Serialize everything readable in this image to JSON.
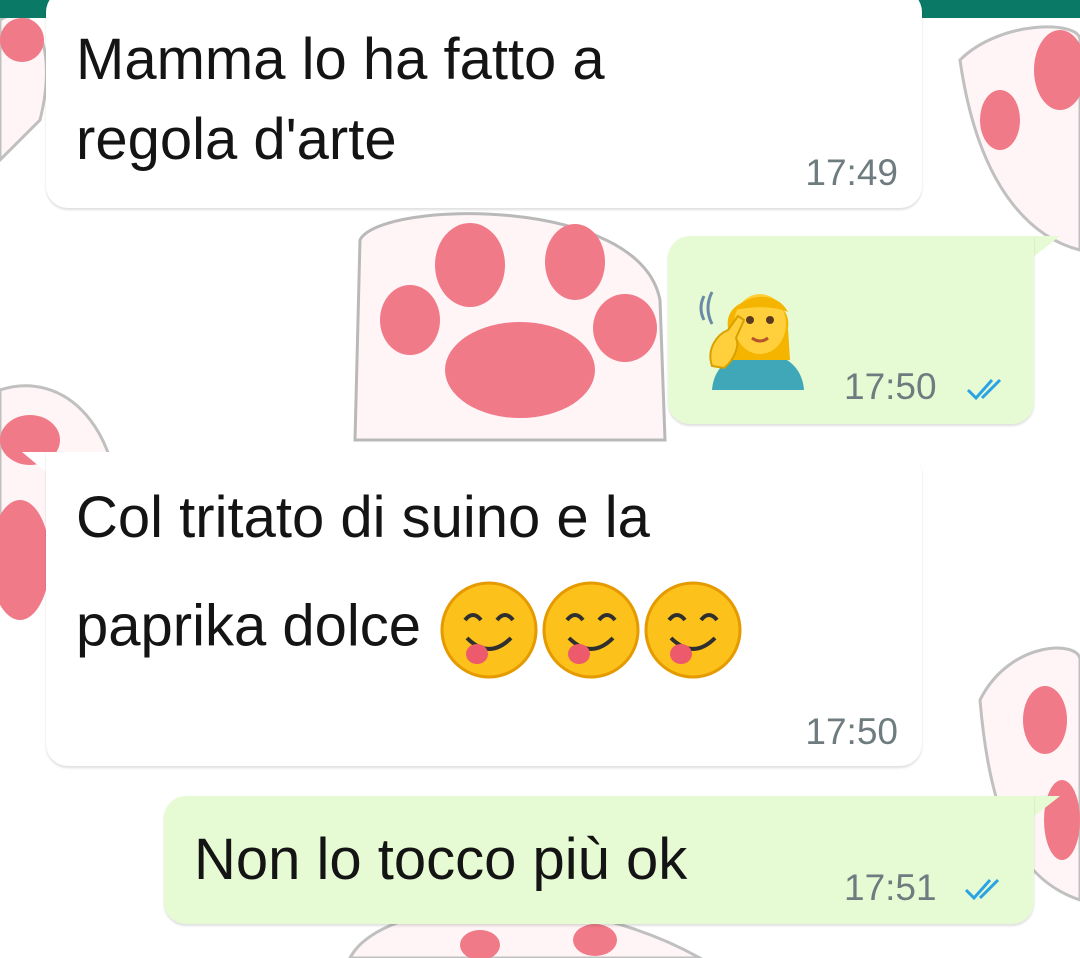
{
  "header": {
    "color": "#0a7a66"
  },
  "colors": {
    "incoming_bubble": "#ffffff",
    "outgoing_bubble": "#e6fbd3",
    "read_ticks": "#2aa3e5",
    "timestamp": "#6e7c80"
  },
  "messages": [
    {
      "direction": "incoming",
      "lines": [
        "Mamma lo ha fatto a",
        "regola d'arte"
      ],
      "time": "17:49"
    },
    {
      "direction": "outgoing",
      "emoji": "woman-shushing-ear-emoji",
      "time": "17:50",
      "status": "read"
    },
    {
      "direction": "incoming",
      "lines": [
        "Col tritato di suino e la",
        "paprika dolce"
      ],
      "emojis": [
        "yum-face-emoji",
        "yum-face-emoji",
        "yum-face-emoji"
      ],
      "time": "17:50"
    },
    {
      "direction": "outgoing",
      "lines": [
        "Non lo tocco più ok"
      ],
      "time": "17:51",
      "status": "read"
    }
  ]
}
